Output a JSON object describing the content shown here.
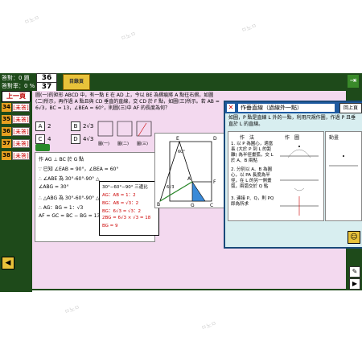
{
  "stats": {
    "correct_label": "答對：0 題",
    "correct_value": "36",
    "rate_label": "答對率：0 %",
    "rate_value": "37"
  },
  "title_button": "目錄頁",
  "sidebar": {
    "prev_page": "上一頁",
    "items": [
      {
        "num": "34",
        "tag": "[未答]"
      },
      {
        "num": "35",
        "tag": "[未答]"
      },
      {
        "num": "36",
        "tag": "[未答]"
      },
      {
        "num": "37",
        "tag": "[未答]"
      },
      {
        "num": "38",
        "tag": "[未答]"
      }
    ],
    "code": "G34A270s"
  },
  "question": {
    "text": "圖(一)的矩形 ABCD 中，有一點 E 在 AD 上，今以 BE 為摺痕將 A 點往右摺，如圖(二)所示，再作過 A 點且與 CD 垂直的直線，交 CD 於 F 點，如圖(三)所示。若 AB = 6√3，BC = 13，∠BEA = 60°，則圖(三)中 AF 的長度為何？",
    "options": [
      {
        "letter": "A",
        "value": "2"
      },
      {
        "letter": "B",
        "value": "2√3"
      },
      {
        "letter": "C",
        "value": "4"
      },
      {
        "letter": "D",
        "value": "4√3"
      }
    ],
    "fig_labels": [
      "圖(一)",
      "圖(二)",
      "圖(三)"
    ]
  },
  "solution": {
    "lines": [
      "作 AG ⊥ BC 於 G 點",
      "∵ 已知 ∠EAB = 90°，∠BEA = 60°",
      "∴ ∠ABE 為 30°-60°-90° △",
      "∠ABG = 30°",
      "∴ △ABG 為 30°-60°-90° △",
      "∴ AG：BG = 1：√3",
      "AF = GC = BC − BG = 13 − 9 = 4"
    ],
    "calc_lines": [
      "30°−60°−90° 三邊比",
      "AG：AB = 1：2",
      "BG：AB = √3：2",
      "BG：6√3 = √3：2",
      "2BG = 6√3 × √3 = 18",
      "BG = 9"
    ]
  },
  "figure_labels": {
    "E": "E",
    "D": "D",
    "A": "A",
    "F": "F",
    "B": "B",
    "G": "G",
    "C": "C",
    "angle": "60°",
    "side": "6√3"
  },
  "popup": {
    "title": "作垂直線（過線外一點）",
    "back": "回上頁",
    "description": "如圖，P 點是直線 L 外的一點，利用尺規作圖，作過 P 且垂直於 L 的直線。",
    "col_method": "作　法",
    "col_drawing": "作　圖",
    "col_anim": "動畫",
    "steps": [
      "1. 以 P 為圓心，適當長 (大於 P 到 L 的距離) 為半徑畫弧，交 L 於 A、B 兩點",
      "2. 分別以 A、B 為圓心，以 PA 長度為半徑，在 L 的另一側畫弧，兩弧交於 Q 點",
      "3. 連接 P、Q，則 PQ 即為所求"
    ]
  }
}
